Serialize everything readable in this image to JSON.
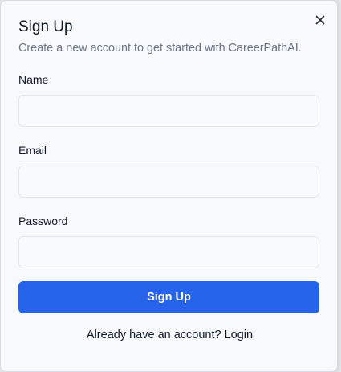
{
  "dialog": {
    "title": "Sign Up",
    "subtitle": "Create a new account to get started with CareerPathAI.",
    "close_icon": "close-icon"
  },
  "form": {
    "name": {
      "label": "Name",
      "value": "",
      "placeholder": ""
    },
    "email": {
      "label": "Email",
      "value": "",
      "placeholder": ""
    },
    "password": {
      "label": "Password",
      "value": "",
      "placeholder": ""
    },
    "submit_label": "Sign Up"
  },
  "footer": {
    "prompt": "Already have an account?",
    "login_link": "Login"
  },
  "colors": {
    "accent": "#2563eb",
    "background": "#f7f9fc",
    "muted_text": "#6b7686"
  }
}
